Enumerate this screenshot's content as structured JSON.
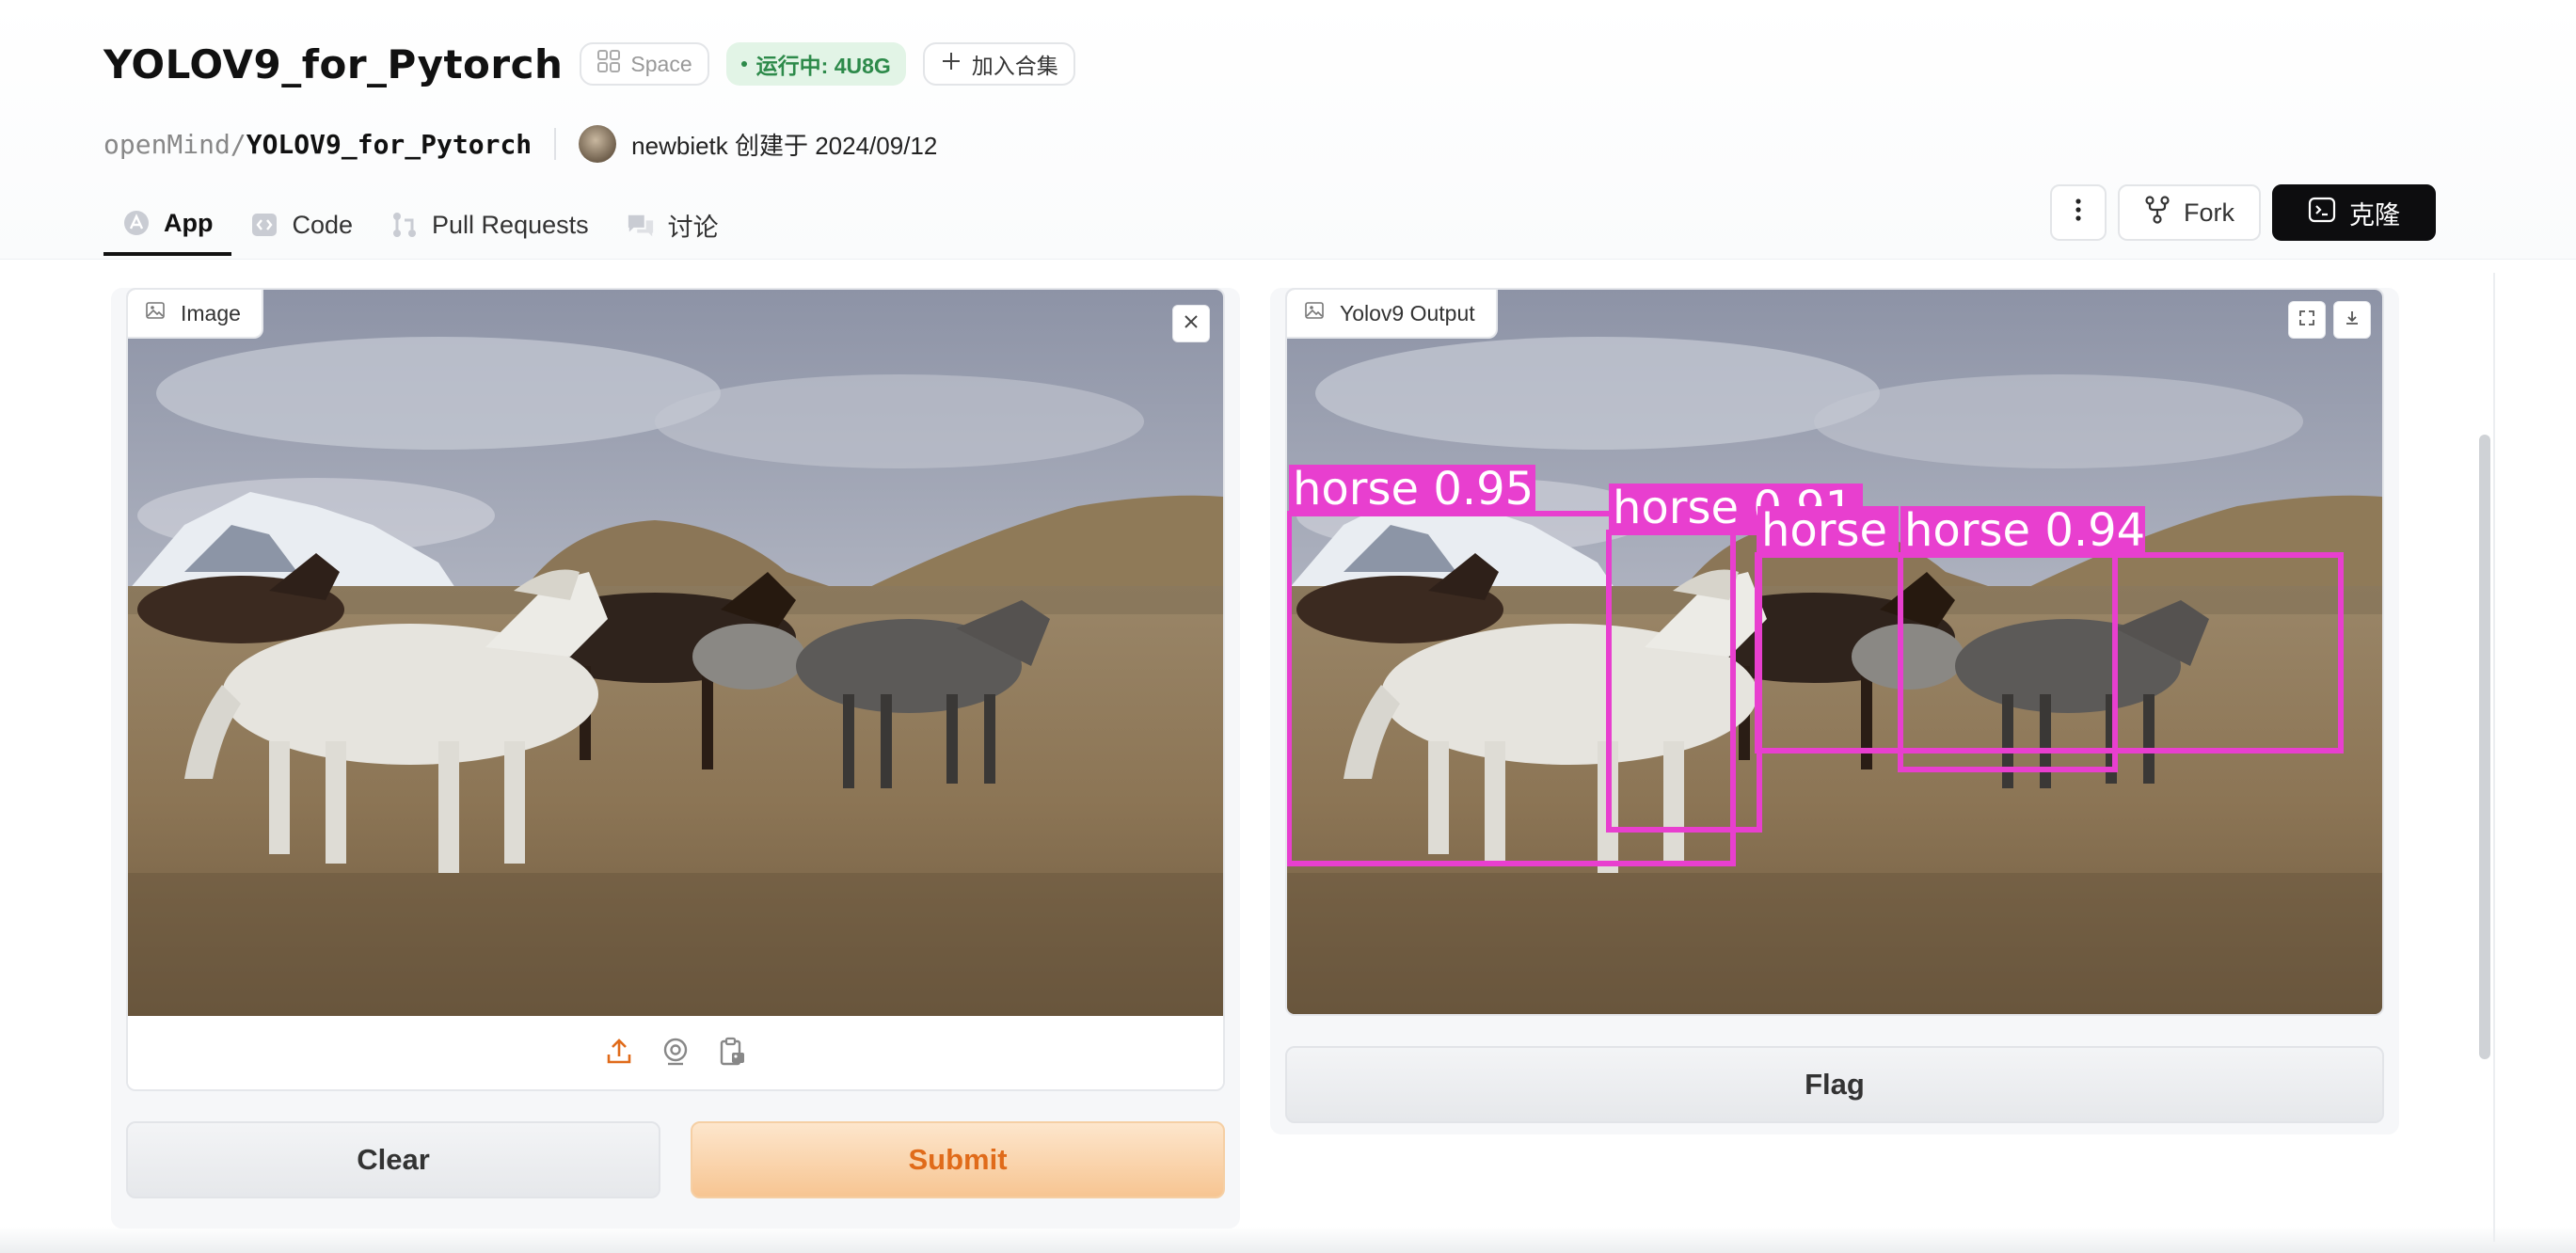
{
  "header": {
    "title": "YOLOV9_for_Pytorch",
    "chips": {
      "space": "Space",
      "running": "运行中: 4U8G",
      "collect": "加入合集"
    },
    "owner": "openMind/",
    "repo_name": "YOLOV9_for_Pytorch",
    "creator_line": "newbietk 创建于 2024/09/12",
    "tabs": [
      {
        "label": "App",
        "icon": "app-icon",
        "active": true
      },
      {
        "label": "Code",
        "icon": "code-icon",
        "active": false
      },
      {
        "label": "Pull Requests",
        "icon": "pull-request-icon",
        "active": false
      },
      {
        "label": "讨论",
        "icon": "discussion-icon",
        "active": false
      }
    ],
    "actions": {
      "fork": "Fork",
      "clone": "克隆"
    }
  },
  "input": {
    "label": "Image",
    "clear": "Clear",
    "submit": "Submit"
  },
  "output": {
    "label": "Yolov9 Output",
    "flag": "Flag",
    "detections": [
      {
        "label": "horse 0.95"
      },
      {
        "label": "horse 0.91"
      },
      {
        "label": "horse"
      },
      {
        "label": "horse 0.94"
      }
    ]
  },
  "colors": {
    "accent_orange": "#e06b1a",
    "running_green": "#2d8a4a",
    "bbox_magenta": "#e83fcf",
    "clone_bg": "#0d0d0f"
  }
}
